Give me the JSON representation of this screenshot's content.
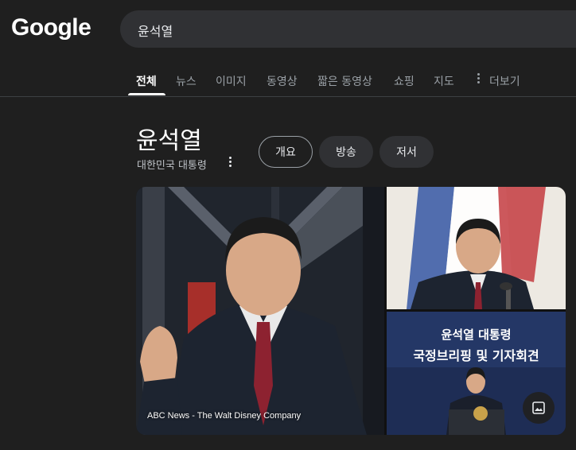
{
  "header": {
    "logo": "Google",
    "search_query": "윤석열"
  },
  "tabs": [
    {
      "label": "전체",
      "active": true
    },
    {
      "label": "뉴스"
    },
    {
      "label": "이미지"
    },
    {
      "label": "동영상"
    },
    {
      "label": "짧은 동영상"
    },
    {
      "label": "쇼핑"
    },
    {
      "label": "지도"
    },
    {
      "label": "더보기"
    }
  ],
  "knowledge_panel": {
    "title": "윤석열",
    "subtitle": "대한민국 대통령",
    "chips": [
      {
        "label": "개요",
        "active": true
      },
      {
        "label": "방송"
      },
      {
        "label": "저서"
      }
    ]
  },
  "gallery": {
    "main_image_credit": "ABC News - The Walt Disney Company",
    "bottom_right_caption_line1": "윤석열 대통령",
    "bottom_right_caption_line2": "국정브리핑 및 기자회견",
    "image_button_icon": "image-icon"
  }
}
